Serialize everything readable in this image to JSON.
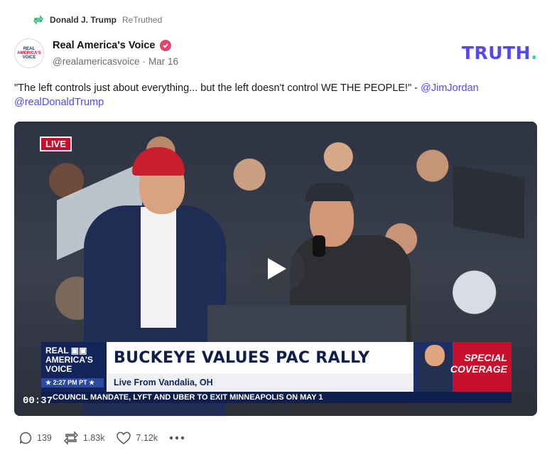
{
  "retruth": {
    "name": "Donald J. Trump",
    "verb": "ReTruthed",
    "icon": "retruth-icon"
  },
  "author": {
    "display_name": "Real America's Voice",
    "handle": "@realamericasvoice",
    "separator": "·",
    "date": "Mar 16",
    "verified_color": "#e0456b",
    "avatar_lines": [
      "REAL",
      "AMERICA'S",
      "VOICE"
    ]
  },
  "brand": {
    "logo_text": "TRUTH",
    "logo_dot": ".",
    "logo_color": "#5448ee"
  },
  "post": {
    "text": "\"The left controls just about everything... but the left doesn't control WE THE PEOPLE!\" - ",
    "mention_1": "@JimJordan",
    "mention_2": "@realDonaldTrump"
  },
  "video": {
    "live_badge": "LIVE",
    "duration": "00:37",
    "chyron": {
      "brand_line_1": "REAL ▣▣",
      "brand_line_2": "AMERICA'S VOICE",
      "time": "★ 2:27 PM PT ★",
      "headline": "BUCKEYE VALUES PAC RALLY",
      "subheadline": "Live From Vandalia, OH",
      "special_line_1": "SPECIAL",
      "special_line_2": "COVERAGE",
      "ticker": "COUNCIL MANDATE, LYFT AND UBER TO EXIT MINNEAPOLIS ON MAY 1"
    }
  },
  "actions": {
    "replies": "139",
    "retruths": "1.83k",
    "likes": "7.12k",
    "more_icon": "more-icon"
  }
}
